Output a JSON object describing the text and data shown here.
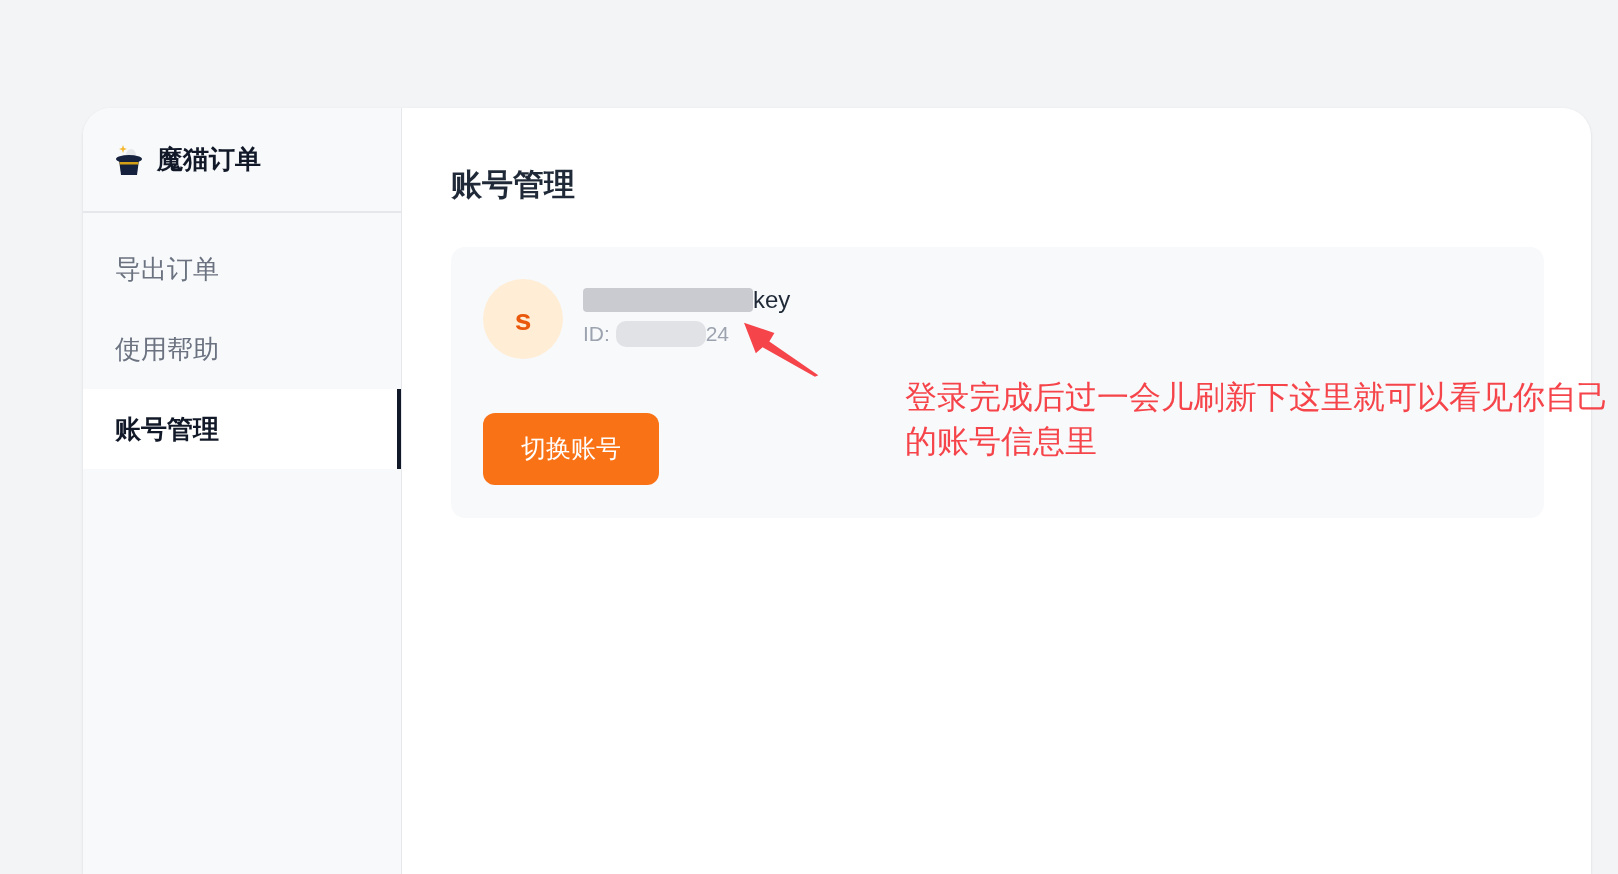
{
  "app": {
    "title": "魔猫订单"
  },
  "sidebar": {
    "items": [
      {
        "label": "导出订单",
        "selected": false
      },
      {
        "label": "使用帮助",
        "selected": false
      },
      {
        "label": "账号管理",
        "selected": true
      }
    ]
  },
  "main": {
    "title": "账号管理",
    "account": {
      "avatar_letter": "s",
      "name_visible": "key",
      "id_label": "ID: ",
      "id_visible": "24"
    },
    "switch_button": "切换账号"
  },
  "annotation": {
    "text": "登录完成后过一会儿刷新下这里就可以看见你自己的账号信息里",
    "color": "#f5454b"
  }
}
